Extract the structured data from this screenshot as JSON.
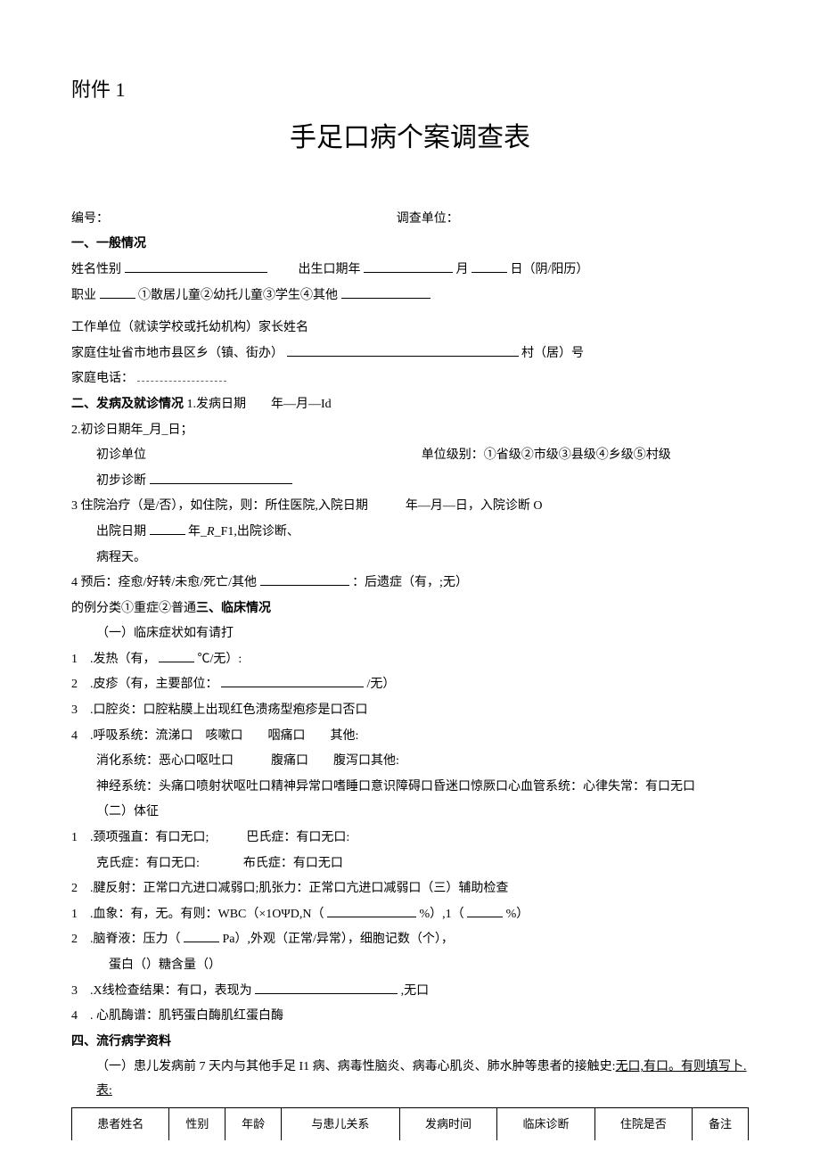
{
  "header": {
    "attachment": "附件 1",
    "title": "手足口病个案调查表"
  },
  "id_line": {
    "number_label": "编号：",
    "unit_label": "调查单位："
  },
  "s1": {
    "head": "一、一般情况",
    "name_sex": "姓名性别",
    "birth_pre": "出生口期年",
    "month": "月",
    "day": "日（阴/阳历）",
    "occ_pre": "职业",
    "occ_opts": "①散居儿童②幼托儿童③学生④其他",
    "workunit": "工作单位（就读学校或托幼机构）家长姓名",
    "addr_pre": "家庭住址省市地市县区乡（镇、街办）",
    "addr_suf": "村（居）号",
    "phone": "家庭电话："
  },
  "s2": {
    "head": "二、发病及就诊情况",
    "l1": "1.发病日期　　年—月—Id",
    "l2": "2.初诊日期年_月_日；",
    "l2a": "初诊单位",
    "l2a_right": "单位级别：①省级②市级③县级④乡级⑤村级",
    "l2b": "初步诊断",
    "l3": "3 住院治疗（是/否），如住院，则：所住医院,入院日期　　　年—月—日，入院诊断 O",
    "l3b_pre": "出院日期",
    "l3b_mid": "年_R_F1,出院诊断、",
    "l3c": "病程天。",
    "l4_pre": "4 预后：痊愈/好转/未愈/死亡/其他",
    "l4_suf": "：后遗症（有，;无）",
    "l5_pre": "的例分类①重症②普通",
    "l5_head": "三、临床情况"
  },
  "s3": {
    "sub1": "（一）临床症状如有请打",
    "i1_pre": "1　.发热（有，",
    "i1_suf": "℃/无）:",
    "i2_pre": "2　.皮疹（有，主要部位：",
    "i2_suf": "/无）",
    "i3": "3　.口腔炎：口腔粘膜上出现红色溃疡型疱疹是口否口",
    "i4": "4　.呼吸系统：流涕口　咳嗽口　　咽痛口　　其他:",
    "i4b": "消化系统：恶心口呕吐口　　　腹痛口　　腹泻口其他:",
    "i4c": "神经系统：头痛口喷射状呕吐口精神异常口嗜睡口意识障碍口昏迷口惊厥口心血管系统：心律失常：有口无口",
    "sub2": "（二）体征",
    "t1a": "1　.颈项强直：有口无口;",
    "t1b": "巴氏症：有口无口:",
    "t1c": "克氏症：有口无口:",
    "t1d": "布氏症：有口无口",
    "t2": "2　.腱反射：正常口亢进口减弱口;肌张力：正常口亢进口减弱口（三）辅助检查",
    "a1_pre": "1　.血象：有，无。有则：WBC（×1OΨD,N（",
    "a1_mid": "%）,1（",
    "a1_suf": "%）",
    "a2_pre": "2　.脑脊液：压力（",
    "a2_suf": "Pa）,外观（正常/异常），细胞记数（个），",
    "a2b": "蛋白（）糖含量（）",
    "a3_pre": "3　.X线检查结果：有口，表现为",
    "a3_suf": ",无口",
    "a4": "4　. 心肌酶谱：肌钙蛋白酶肌红蛋白酶"
  },
  "s4": {
    "head": "四、流行病学资料",
    "p1_pre": "（一）患儿发病前 7 天内与其他手足 I1 病、病毒性脑炎、病毒心肌炎、肺水肿等患者的接触史:",
    "p1_u": "无口,有口。有则填写卜.表:",
    "tbl": {
      "c1": "患者姓名",
      "c2": "性别",
      "c3": "年龄",
      "c4": "与患儿关系",
      "c5": "发病时间",
      "c6": "临床诊断",
      "c7": "住院是否",
      "c8": "备注"
    }
  }
}
